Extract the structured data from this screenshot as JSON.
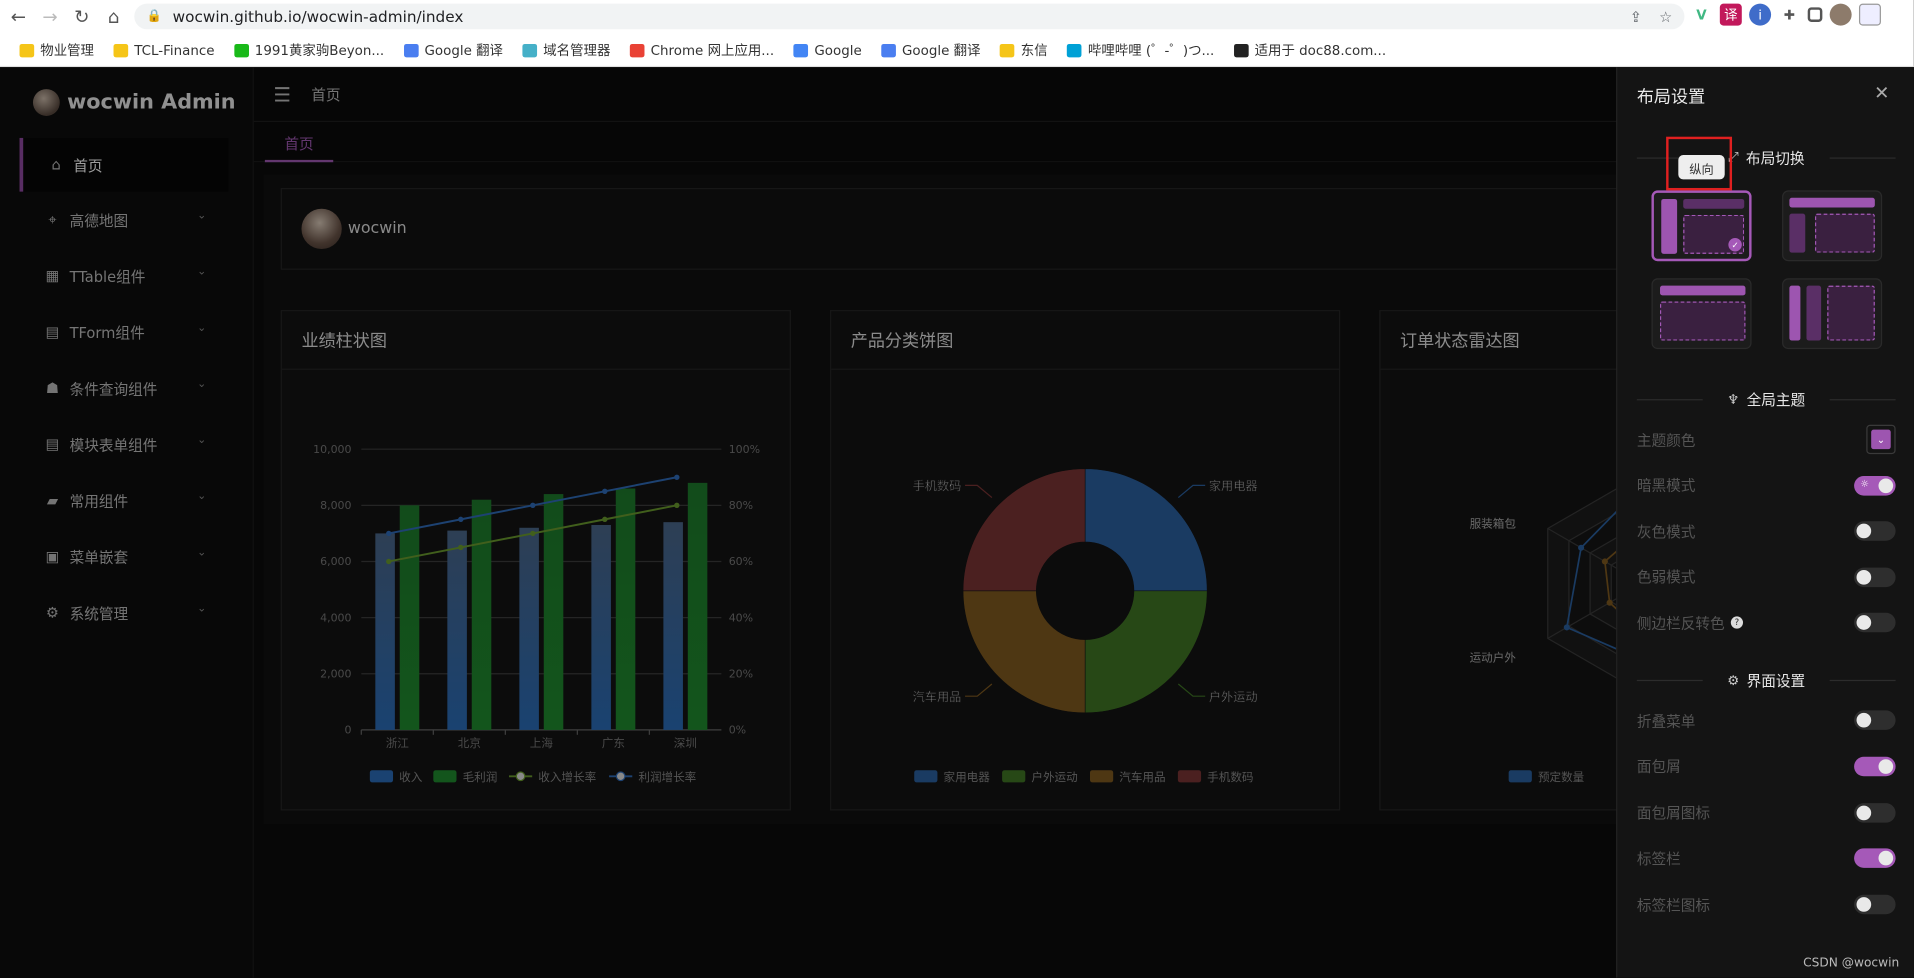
{
  "browser": {
    "url": "wocwin.github.io/wocwin-admin/index",
    "bookmarks": [
      {
        "label": "物业管理",
        "icon": "folder",
        "color": "#f5c518"
      },
      {
        "label": "TCL-Finance",
        "icon": "folder",
        "color": "#f5c518"
      },
      {
        "label": "1991黄家驹Beyon...",
        "icon": "iqiyi",
        "color": "#19b919"
      },
      {
        "label": "Google 翻译",
        "icon": "translate",
        "color": "#4a7ef0"
      },
      {
        "label": "域名管理器",
        "icon": "domain",
        "color": "#45b0c8"
      },
      {
        "label": "Chrome 网上应用...",
        "icon": "chrome-store",
        "color": "#e94235"
      },
      {
        "label": "Google",
        "icon": "google",
        "color": "#4285f4"
      },
      {
        "label": "Google 翻译",
        "icon": "translate",
        "color": "#4a7ef0"
      },
      {
        "label": "东信",
        "icon": "folder",
        "color": "#f5c518"
      },
      {
        "label": "哔哩哔哩 (゜-゜)つ...",
        "icon": "bilibili",
        "color": "#00a1d6"
      },
      {
        "label": "适用于 doc88.com...",
        "icon": "doc88",
        "color": "#222222"
      }
    ]
  },
  "app": {
    "logo": "wocwin Admin",
    "menu": [
      {
        "label": "首页",
        "icon": "home-icon",
        "active": true,
        "chevron": false
      },
      {
        "label": "高德地图",
        "icon": "map-pin-icon",
        "chevron": true
      },
      {
        "label": "TTable组件",
        "icon": "grid-icon",
        "chevron": true
      },
      {
        "label": "TForm组件",
        "icon": "form-icon",
        "chevron": true
      },
      {
        "label": "条件查询组件",
        "icon": "query-icon",
        "chevron": true
      },
      {
        "label": "模块表单组件",
        "icon": "module-form-icon",
        "chevron": true
      },
      {
        "label": "常用组件",
        "icon": "briefcase-icon",
        "chevron": true
      },
      {
        "label": "菜单嵌套",
        "icon": "clipboard-icon",
        "chevron": true
      },
      {
        "label": "系统管理",
        "icon": "gear-icon",
        "chevron": true
      }
    ],
    "breadcrumb": "首页",
    "tab": "首页",
    "username": "wocwin",
    "cards": {
      "bar_title": "业绩柱状图",
      "pie_title": "产品分类饼图",
      "radar_title": "订单状态雷达图"
    },
    "accent": "#a559b8"
  },
  "chart_data": [
    {
      "type": "bar",
      "title": "业绩柱状图",
      "categories": [
        "浙江",
        "北京",
        "上海",
        "广东",
        "深圳"
      ],
      "ylim": [
        0,
        10000
      ],
      "yticks": [
        "0",
        "2,000",
        "4,000",
        "6,000",
        "8,000",
        "10,000"
      ],
      "y2lim": [
        0,
        100
      ],
      "y2ticks": [
        "0%",
        "20%",
        "40%",
        "60%",
        "80%",
        "100%"
      ],
      "series": [
        {
          "name": "收入",
          "kind": "bar",
          "color": "#2a6bb6",
          "values": [
            7000,
            7100,
            7200,
            7300,
            7400
          ]
        },
        {
          "name": "毛利润",
          "kind": "bar",
          "color": "#1f8a2e",
          "values": [
            8000,
            8200,
            8400,
            8600,
            8800
          ]
        },
        {
          "name": "收入增长率",
          "kind": "line",
          "color": "#6a9a2e",
          "axis": "right",
          "values": [
            60,
            65,
            70,
            75,
            80
          ]
        },
        {
          "name": "利润增长率",
          "kind": "line",
          "color": "#2f6bb8",
          "axis": "right",
          "values": [
            70,
            75,
            80,
            85,
            90
          ]
        }
      ]
    },
    {
      "type": "pie",
      "title": "产品分类饼图",
      "donut": true,
      "slices": [
        {
          "name": "家用电器",
          "value": 25,
          "color": "#2a5f9e"
        },
        {
          "name": "户外运动",
          "value": 25,
          "color": "#3f7424"
        },
        {
          "name": "汽车用品",
          "value": 25,
          "color": "#7f5920"
        },
        {
          "name": "手机数码",
          "value": 25,
          "color": "#7a3434"
        }
      ]
    },
    {
      "type": "radar",
      "title": "订单状态雷达图",
      "indicators": [
        "服装箱包",
        "运动户外"
      ],
      "series": [
        {
          "name": "预定数量",
          "color": "#2a5f9e"
        }
      ]
    }
  ],
  "drawer": {
    "title": "布局设置",
    "section_layout": "布局切换",
    "tooltip": "纵向",
    "section_theme": "全局主题",
    "section_ui": "界面设置",
    "theme_rows": [
      {
        "label": "主题颜色",
        "type": "color",
        "value": "#9d55b0"
      },
      {
        "label": "暗黑模式",
        "type": "switch",
        "on": true
      },
      {
        "label": "灰色模式",
        "type": "switch",
        "on": false
      },
      {
        "label": "色弱模式",
        "type": "switch",
        "on": false
      },
      {
        "label": "侧边栏反转色",
        "type": "switch",
        "on": false,
        "help": "?"
      }
    ],
    "ui_rows": [
      {
        "label": "折叠菜单",
        "on": false
      },
      {
        "label": "面包屑",
        "on": true
      },
      {
        "label": "面包屑图标",
        "on": false
      },
      {
        "label": "标签栏",
        "on": true
      },
      {
        "label": "标签栏图标",
        "on": false
      }
    ]
  },
  "watermark": "CSDN @wocwin"
}
